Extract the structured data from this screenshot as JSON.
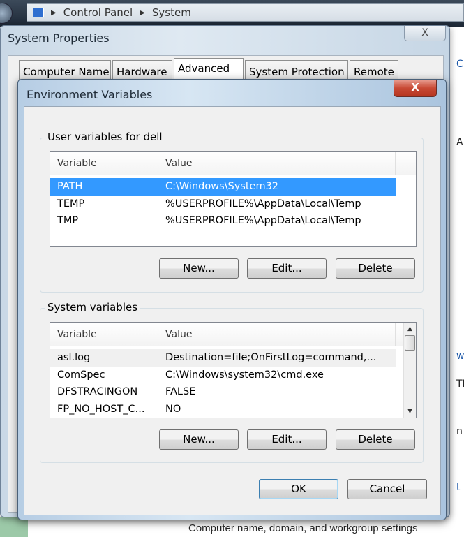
{
  "address_bar": {
    "breadcrumbs": [
      "Control Panel",
      "System"
    ],
    "icon": "computer-icon"
  },
  "background": {
    "bottom_text": "Computer name, domain, and workgroup settings",
    "right_fragments": [
      "C",
      "A",
      "w",
      "TI",
      "n",
      "t"
    ]
  },
  "system_properties": {
    "title": "System Properties",
    "close_label": "X",
    "tabs": [
      {
        "label": "Computer Name"
      },
      {
        "label": "Hardware"
      },
      {
        "label": "Advanced",
        "selected": true
      },
      {
        "label": "System Protection"
      },
      {
        "label": "Remote"
      }
    ]
  },
  "env_dialog": {
    "title": "Environment Variables",
    "close_label": "X",
    "user_group": {
      "label": "User variables for dell",
      "headers": [
        "Variable",
        "Value"
      ],
      "rows": [
        {
          "var": "PATH",
          "value": "C:\\Windows\\System32",
          "selected": true
        },
        {
          "var": "TEMP",
          "value": "%USERPROFILE%\\AppData\\Local\\Temp"
        },
        {
          "var": "TMP",
          "value": "%USERPROFILE%\\AppData\\Local\\Temp"
        }
      ],
      "buttons": [
        "New...",
        "Edit...",
        "Delete"
      ]
    },
    "system_group": {
      "label": "System variables",
      "headers": [
        "Variable",
        "Value"
      ],
      "rows": [
        {
          "var": "asl.log",
          "value": "Destination=file;OnFirstLog=command,..."
        },
        {
          "var": "ComSpec",
          "value": "C:\\Windows\\system32\\cmd.exe"
        },
        {
          "var": "DFSTRACINGON",
          "value": "FALSE"
        },
        {
          "var": "FP_NO_HOST_C...",
          "value": "NO"
        }
      ],
      "buttons": [
        "New...",
        "Edit...",
        "Delete"
      ]
    },
    "ok_label": "OK",
    "cancel_label": "Cancel"
  }
}
